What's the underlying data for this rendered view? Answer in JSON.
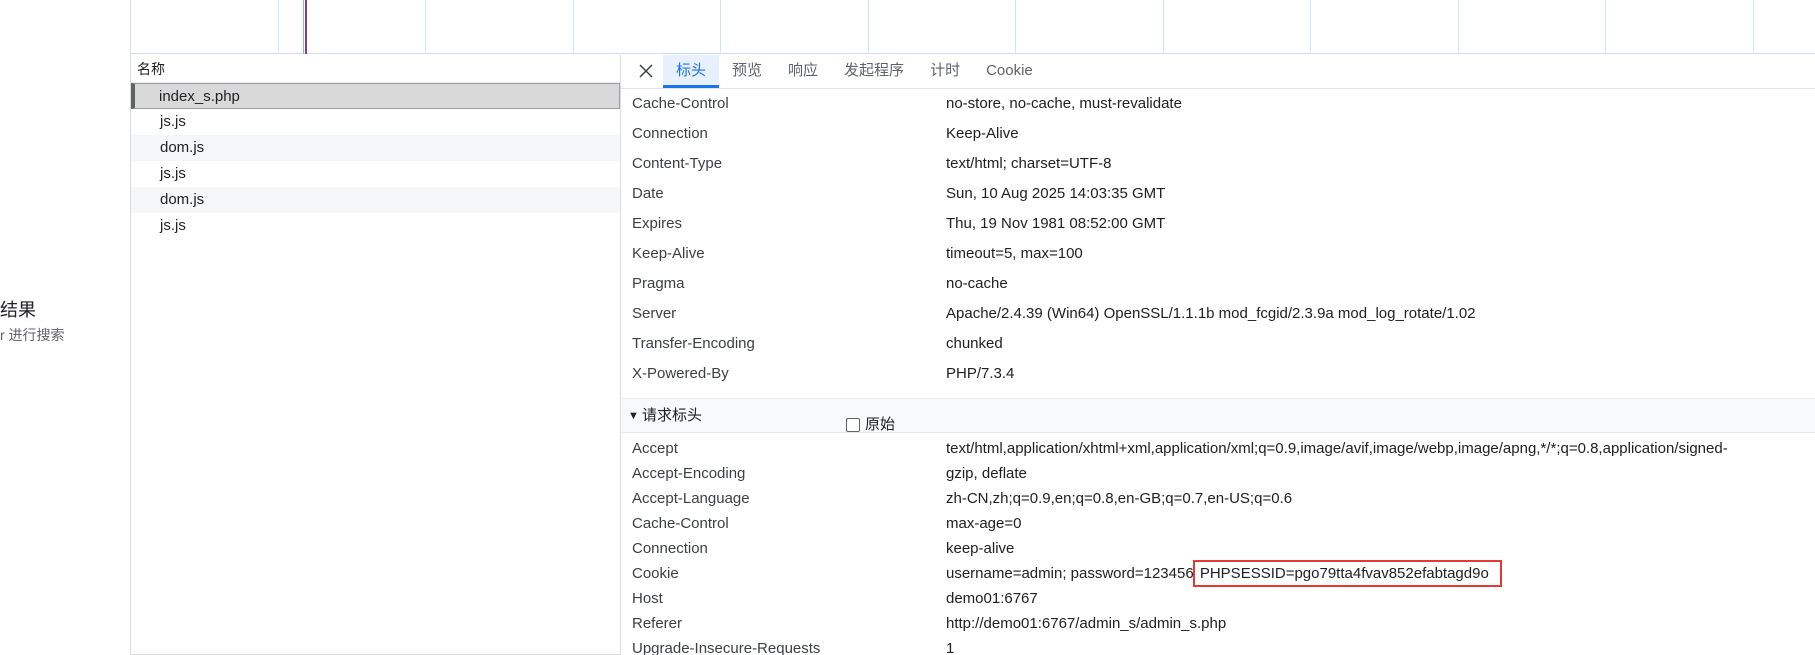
{
  "left": {
    "result_title": "结果",
    "result_hint": "r 进行搜索"
  },
  "name_list": {
    "header": "名称",
    "items": [
      "index_s.php",
      "js.js",
      "dom.js",
      "js.js",
      "dom.js",
      "js.js"
    ],
    "selected_index": 0
  },
  "tabs": [
    "标头",
    "预览",
    "响应",
    "发起程序",
    "计时",
    "Cookie"
  ],
  "active_tab": 0,
  "response_headers": [
    {
      "key": "Cache-Control",
      "value": "no-store, no-cache, must-revalidate"
    },
    {
      "key": "Connection",
      "value": "Keep-Alive"
    },
    {
      "key": "Content-Type",
      "value": "text/html; charset=UTF-8"
    },
    {
      "key": "Date",
      "value": "Sun, 10 Aug 2025 14:03:35 GMT"
    },
    {
      "key": "Expires",
      "value": "Thu, 19 Nov 1981 08:52:00 GMT"
    },
    {
      "key": "Keep-Alive",
      "value": "timeout=5, max=100"
    },
    {
      "key": "Pragma",
      "value": "no-cache"
    },
    {
      "key": "Server",
      "value": "Apache/2.4.39 (Win64) OpenSSL/1.1.1b mod_fcgid/2.3.9a mod_log_rotate/1.02"
    },
    {
      "key": "Transfer-Encoding",
      "value": "chunked"
    },
    {
      "key": "X-Powered-By",
      "value": "PHP/7.3.4"
    }
  ],
  "request_section": {
    "title": "请求标头",
    "raw_label": "原始",
    "raw_checked": false
  },
  "request_headers": [
    {
      "key": "Accept",
      "value": "text/html,application/xhtml+xml,application/xml;q=0.9,image/avif,image/webp,image/apng,*/*;q=0.8,application/signed-"
    },
    {
      "key": "Accept-Encoding",
      "value": "gzip, deflate"
    },
    {
      "key": "Accept-Language",
      "value": "zh-CN,zh;q=0.9,en;q=0.8,en-GB;q=0.7,en-US;q=0.6"
    },
    {
      "key": "Cache-Control",
      "value": "max-age=0"
    },
    {
      "key": "Connection",
      "value": "keep-alive"
    },
    {
      "key": "Cookie",
      "value": "username=admin; password=123456",
      "highlight": "PHPSESSID=pgo79tta4fvav852efabtagd9o"
    },
    {
      "key": "Host",
      "value": "demo01:6767"
    },
    {
      "key": "Referer",
      "value": "http://demo01:6767/admin_s/admin_s.php"
    },
    {
      "key": "Upgrade-Insecure-Requests",
      "value": "1"
    }
  ],
  "colors": {
    "accent": "#1a73e8",
    "highlight_box": "#e53935",
    "selected_row": "#d9d9d9"
  }
}
